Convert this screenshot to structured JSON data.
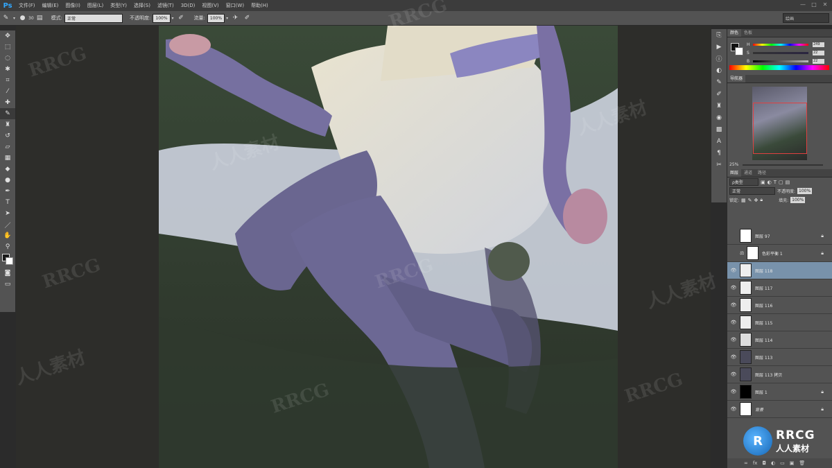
{
  "app": {
    "logo": "Ps"
  },
  "menubar": {
    "items": [
      "文件(F)",
      "编辑(E)",
      "图像(I)",
      "图层(L)",
      "类型(Y)",
      "选择(S)",
      "滤镜(T)",
      "3D(D)",
      "视图(V)",
      "窗口(W)",
      "帮助(H)"
    ],
    "window_buttons": [
      "—",
      "□",
      "✕"
    ]
  },
  "options_bar": {
    "brush_size": "30",
    "mode_label": "模式:",
    "mode_value": "正常",
    "opacity_label": "不透明度:",
    "opacity_value": "100%",
    "flow_label": "流量:",
    "flow_value": "100%",
    "workspace": "绘画"
  },
  "color_panel": {
    "tabs": [
      "颜色",
      "色板"
    ],
    "h_label": "H",
    "h_value": "249",
    "s_label": "S",
    "s_value": "22",
    "b_label": "B",
    "b_value": "22"
  },
  "navigator": {
    "tabs": [
      "导航器"
    ],
    "zoom": "25%"
  },
  "layers_panel": {
    "tabs": [
      "图层",
      "通道",
      "路径"
    ],
    "filter": "ρ类型",
    "blend_mode": "正常",
    "opacity_label": "不透明度:",
    "opacity_value": "100%",
    "lock_label": "锁定:",
    "fill_label": "填充:",
    "fill_value": "100%",
    "layers": [
      {
        "name": "图层 97",
        "visible": false,
        "locked": true
      },
      {
        "name": "色彩平衡 1",
        "visible": false,
        "locked": true
      },
      {
        "name": "图层 118",
        "visible": true,
        "locked": false,
        "selected": true
      },
      {
        "name": "图层 117",
        "visible": true,
        "locked": false
      },
      {
        "name": "图层 116",
        "visible": true,
        "locked": false
      },
      {
        "name": "图层 115",
        "visible": true,
        "locked": false
      },
      {
        "name": "图层 114",
        "visible": true,
        "locked": false
      },
      {
        "name": "图层 113",
        "visible": true,
        "locked": false
      },
      {
        "name": "图层 113 拷贝",
        "visible": true,
        "locked": false
      },
      {
        "name": "图层 1",
        "visible": true,
        "locked": true
      },
      {
        "name": "背景",
        "visible": true,
        "locked": true
      }
    ]
  },
  "watermarks": {
    "rrcg": "RRCG",
    "cn": "人人素材",
    "logo_en": "RRCG",
    "logo_cn": "人人素材"
  }
}
